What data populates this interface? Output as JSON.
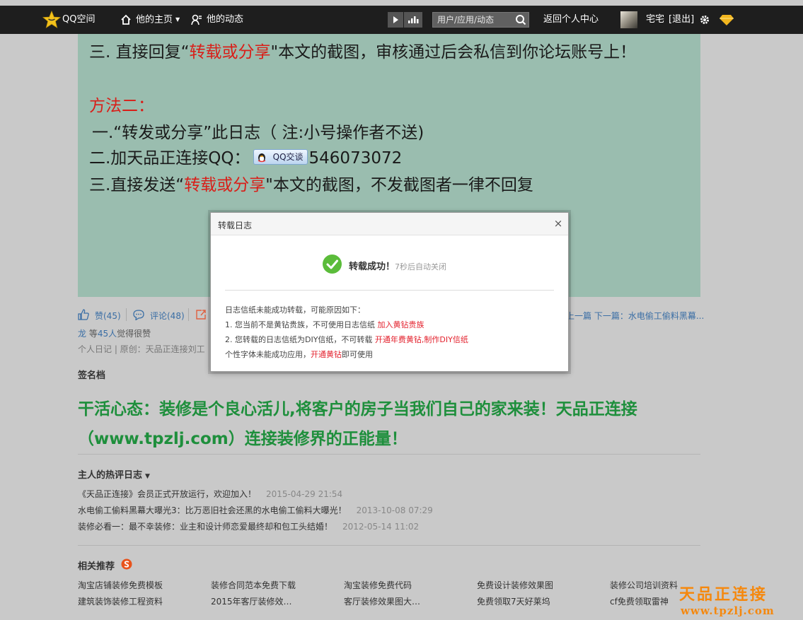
{
  "topbar": {
    "logo": "QQ空间",
    "home": "他的主页",
    "feed": "他的动态",
    "search_placeholder": "用户/应用/动态",
    "back_center": "返回个人中心",
    "username": "宅宅",
    "logout": "[退出]"
  },
  "article": {
    "line1": {
      "a": "三. 直接回复“",
      "b": "转载或分享",
      "c": "\"本文的截图，审核通过后会私信到你论坛账号上！"
    },
    "method2": "方法二：",
    "line2": "一.“转发或分享”此日志（ 注:小号操作者不送)",
    "line3": {
      "a": "二.加天品正连接QQ：",
      "badge": "QQ交谈",
      "b": "546073072"
    },
    "line4": {
      "a": "三.直接发送“",
      "b": "转载或分享",
      "c": "\"本文的截图，不发截图者一律不回复"
    }
  },
  "actions": {
    "like": "赞(45)",
    "comment": "评论(48)",
    "prevnext": "上一篇 下一篇：水电偷工偷料黑幕..."
  },
  "likes_line": {
    "name": "龙",
    "mid": " 等",
    "count": "45人",
    "tail": "觉得很赞"
  },
  "meta_line": "个人日记 | 原创：天品正连接刘工",
  "signature": {
    "title": "签名档",
    "text": "干活心态：装修是个良心活儿,将客户的房子当我们自己的家来装！天品正连接（www.tpzlj.com）连接装修界的正能量！"
  },
  "hot": {
    "title": "主人的热评日志",
    "items": [
      {
        "title": "《天品正连接》会员正式开放运行，欢迎加入！",
        "date": "2015-04-29 21:54"
      },
      {
        "title": "水电偷工偷料黑幕大曝光3：比万恶旧社会还黑的水电偷工偷料大曝光！",
        "date": "2013-10-08 07:29"
      },
      {
        "title": "装修必看一：最不幸装修：业主和设计师恋爱最终却和包工头结婚！",
        "date": "2012-05-14 11:02"
      }
    ]
  },
  "related": {
    "title": "相关推荐",
    "row1": [
      "淘宝店铺装修免费模板",
      "装修合同范本免费下载",
      "淘宝装修免费代码",
      "免费设计装修效果图",
      "装修公司培训资料"
    ],
    "row2": [
      "建筑装饰装修工程资料",
      "2015年客厅装修效…",
      "客厅装修效果图大…",
      "免费领取7天好莱坞",
      "cf免费领取雷神"
    ]
  },
  "watermark": {
    "name": "天品正连接",
    "url": "www.tpzlj.com"
  },
  "dialog": {
    "title": "转载日志",
    "close": "×",
    "success": "转载成功！",
    "countdown": "7秒后自动关闭",
    "reason_head": "日志信纸未能成功转载，可能原因如下：",
    "reason1": {
      "text": "1. 您当前不是黄钻贵族，不可使用日志信纸 ",
      "link": "加入黄钻贵族"
    },
    "reason2": {
      "text": "2. 您转载的日志信纸为DIY信纸，不可转载 ",
      "link": "开通年费黄钻,制作DIY信纸"
    },
    "reason3": {
      "a": "个性字体未能成功应用，",
      "link": "开通黄钻",
      "b": "即可使用"
    }
  },
  "colors": {
    "topbar": "#1e1e1e",
    "article_bg": "#9abdaf",
    "red": "#d91e18",
    "green": "#1e8f3c",
    "link": "#3a6ea5",
    "watermark": "#f5880e"
  }
}
